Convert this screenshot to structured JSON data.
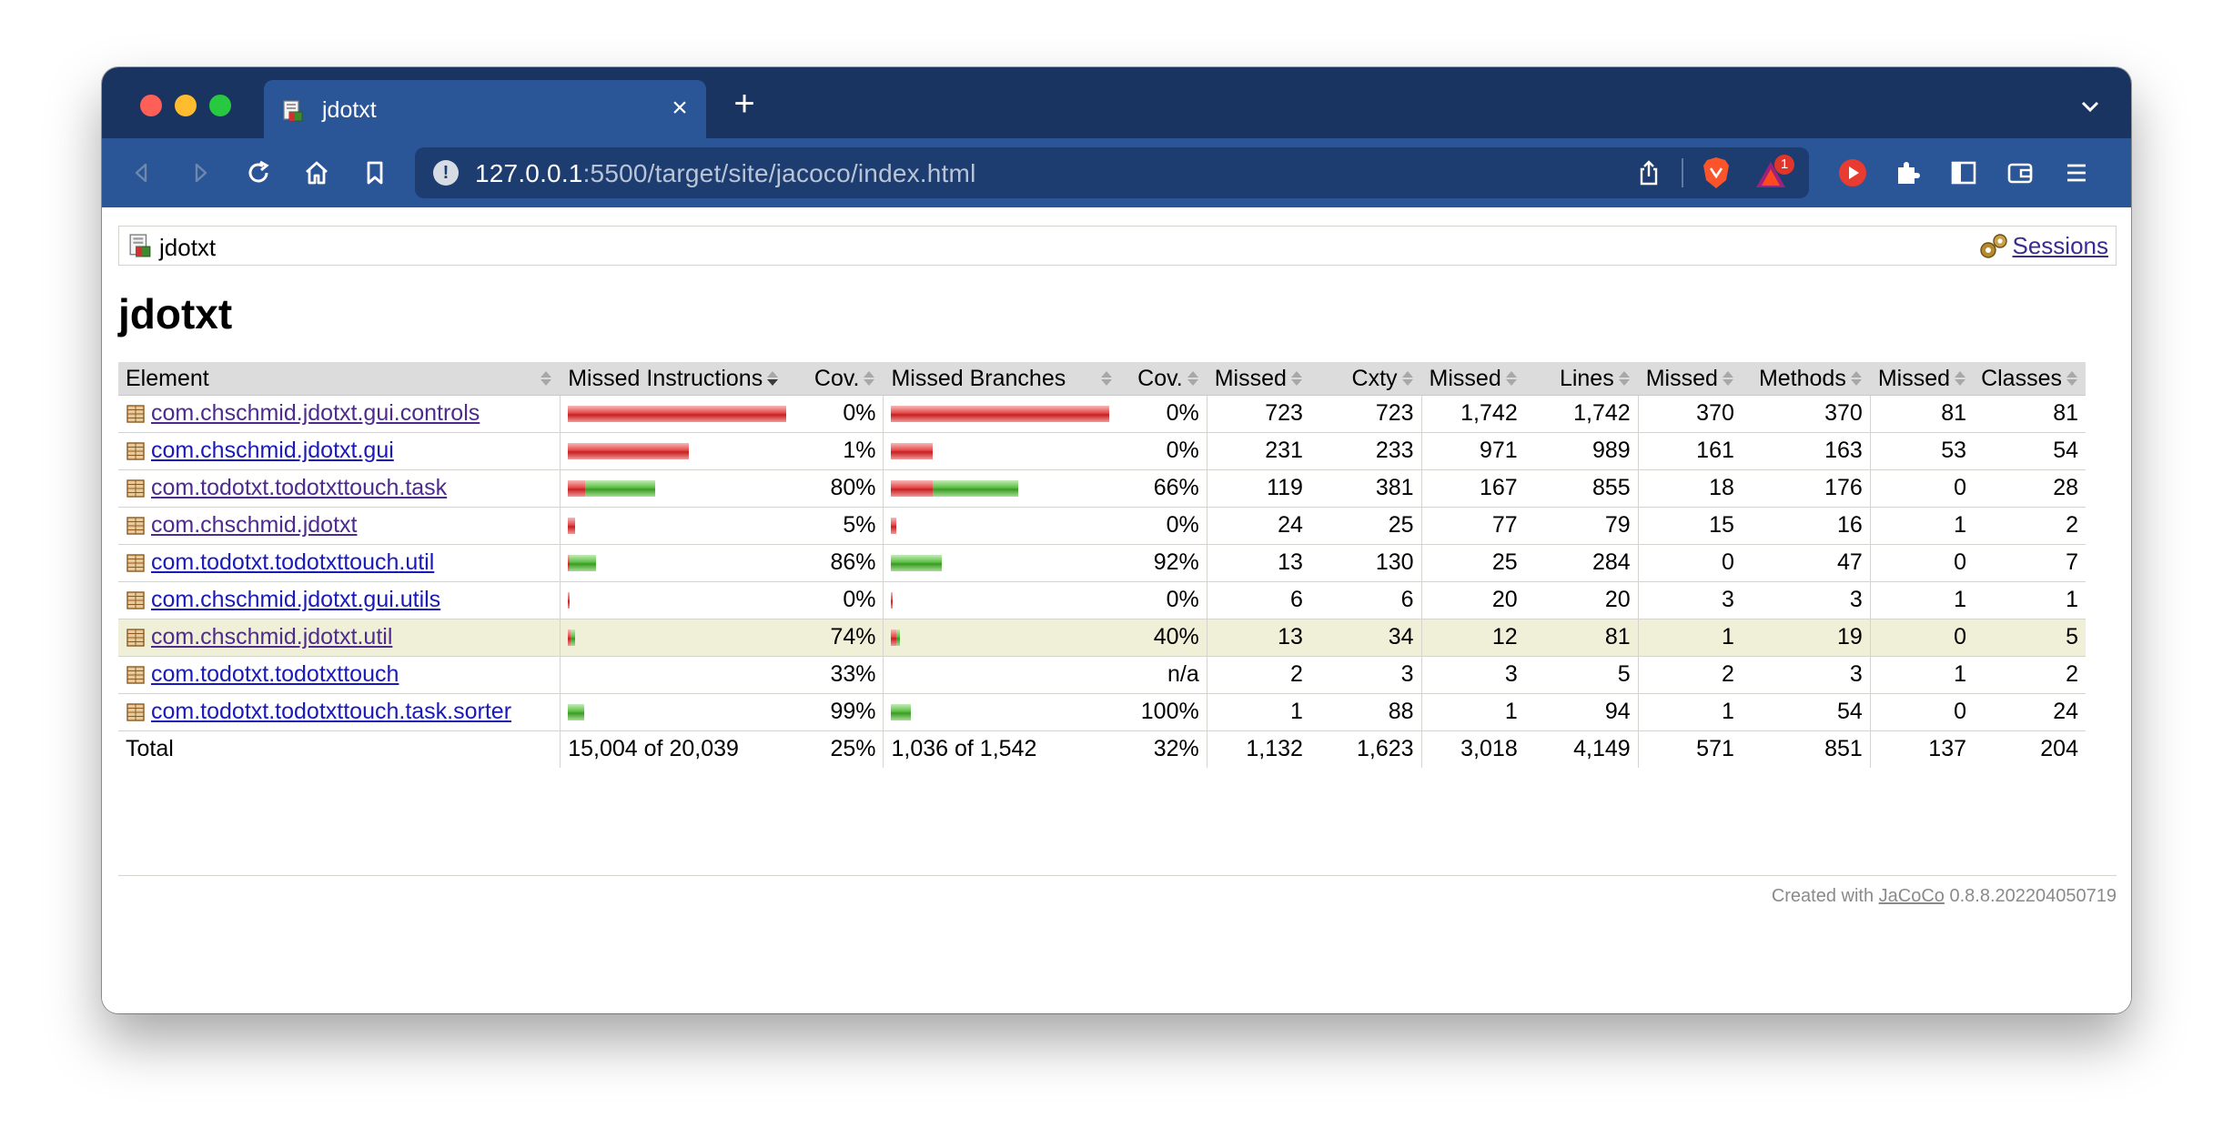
{
  "browser": {
    "tab_title": "jdotxt",
    "url_host": "127.0.0.1",
    "url_rest": ":5500/target/site/jacoco/index.html",
    "notification_count": "1",
    "accent": "#2a5698",
    "titlebar_color": "#1a3461"
  },
  "breadcrumb": {
    "label": "jdotxt",
    "sessions_label": "Sessions"
  },
  "page": {
    "title": "jdotxt"
  },
  "table": {
    "headers": {
      "element": "Element",
      "missed_instructions": "Missed Instructions",
      "instr_cov": "Cov.",
      "missed_branches": "Missed Branches",
      "branch_cov": "Cov.",
      "cxty_missed": "Missed",
      "cxty": "Cxty",
      "lines_missed": "Missed",
      "lines": "Lines",
      "methods_missed": "Missed",
      "methods": "Methods",
      "classes_missed": "Missed",
      "classes": "Classes"
    },
    "rows": [
      {
        "element": "com.chschmid.jdotxt.gui.controls",
        "visited": true,
        "instr_red": 1.0,
        "instr_green": 0.0,
        "instr_cov": "0%",
        "br_red": 1.0,
        "br_green": 0.0,
        "br_cov": "0%",
        "cxty_missed": "723",
        "cxty": "723",
        "lines_missed": "1,742",
        "lines": "1,742",
        "methods_missed": "370",
        "methods": "370",
        "classes_missed": "81",
        "classes": "81",
        "highlight": false
      },
      {
        "element": "com.chschmid.jdotxt.gui",
        "visited": false,
        "instr_red": 0.555,
        "instr_green": 0.0,
        "instr_cov": "1%",
        "br_red": 0.19,
        "br_green": 0.0,
        "br_cov": "0%",
        "cxty_missed": "231",
        "cxty": "233",
        "lines_missed": "971",
        "lines": "989",
        "methods_missed": "161",
        "methods": "163",
        "classes_missed": "53",
        "classes": "54",
        "highlight": false
      },
      {
        "element": "com.todotxt.todotxttouch.task",
        "visited": true,
        "instr_red": 0.08,
        "instr_green": 0.32,
        "instr_cov": "80%",
        "br_red": 0.19,
        "br_green": 0.39,
        "br_cov": "66%",
        "cxty_missed": "119",
        "cxty": "381",
        "lines_missed": "167",
        "lines": "855",
        "methods_missed": "18",
        "methods": "176",
        "classes_missed": "0",
        "classes": "28",
        "highlight": false
      },
      {
        "element": "com.chschmid.jdotxt",
        "visited": true,
        "instr_red": 0.032,
        "instr_green": 0.0,
        "instr_cov": "5%",
        "br_red": 0.025,
        "br_green": 0.0,
        "br_cov": "0%",
        "cxty_missed": "24",
        "cxty": "25",
        "lines_missed": "77",
        "lines": "79",
        "methods_missed": "15",
        "methods": "16",
        "classes_missed": "1",
        "classes": "2",
        "highlight": false
      },
      {
        "element": "com.todotxt.todotxttouch.util",
        "visited": false,
        "instr_red": 0.01,
        "instr_green": 0.12,
        "instr_cov": "86%",
        "br_red": 0.0,
        "br_green": 0.235,
        "br_cov": "92%",
        "cxty_missed": "13",
        "cxty": "130",
        "lines_missed": "25",
        "lines": "284",
        "methods_missed": "0",
        "methods": "47",
        "classes_missed": "0",
        "classes": "7",
        "highlight": false
      },
      {
        "element": "com.chschmid.jdotxt.gui.utils",
        "visited": false,
        "instr_red": 0.01,
        "instr_green": 0.0,
        "instr_cov": "0%",
        "br_red": 0.01,
        "br_green": 0.0,
        "br_cov": "0%",
        "cxty_missed": "6",
        "cxty": "6",
        "lines_missed": "20",
        "lines": "20",
        "methods_missed": "3",
        "methods": "3",
        "classes_missed": "1",
        "classes": "1",
        "highlight": false
      },
      {
        "element": "com.chschmid.jdotxt.util",
        "visited": true,
        "instr_red": 0.012,
        "instr_green": 0.022,
        "instr_cov": "74%",
        "br_red": 0.025,
        "br_green": 0.018,
        "br_cov": "40%",
        "cxty_missed": "13",
        "cxty": "34",
        "lines_missed": "12",
        "lines": "81",
        "methods_missed": "1",
        "methods": "19",
        "classes_missed": "0",
        "classes": "5",
        "highlight": true
      },
      {
        "element": "com.todotxt.todotxttouch",
        "visited": false,
        "instr_red": 0.0,
        "instr_green": 0.0,
        "instr_cov": "33%",
        "br_red": 0.0,
        "br_green": 0.0,
        "br_cov": "n/a",
        "cxty_missed": "2",
        "cxty": "3",
        "lines_missed": "3",
        "lines": "5",
        "methods_missed": "2",
        "methods": "3",
        "classes_missed": "1",
        "classes": "2",
        "highlight": false
      },
      {
        "element": "com.todotxt.todotxttouch.task.sorter",
        "visited": false,
        "instr_red": 0.0,
        "instr_green": 0.075,
        "instr_cov": "99%",
        "br_red": 0.0,
        "br_green": 0.09,
        "br_cov": "100%",
        "cxty_missed": "1",
        "cxty": "88",
        "lines_missed": "1",
        "lines": "94",
        "methods_missed": "1",
        "methods": "54",
        "classes_missed": "0",
        "classes": "24",
        "highlight": false
      }
    ],
    "total": {
      "label": "Total",
      "instructions": "15,004 of 20,039",
      "instr_cov": "25%",
      "branches": "1,036 of 1,542",
      "br_cov": "32%",
      "cxty_missed": "1,132",
      "cxty": "1,623",
      "lines_missed": "3,018",
      "lines": "4,149",
      "methods_missed": "571",
      "methods": "851",
      "classes_missed": "137",
      "classes": "204"
    }
  },
  "footer": {
    "prefix": "Created with ",
    "link": "JaCoCo",
    "version": " 0.8.8.202204050719"
  },
  "colors": {
    "missed_red": "#e54848",
    "covered_green": "#5bbf43",
    "highlight_row": "#f0f0d8",
    "header_bg": "#dcdcdc"
  }
}
